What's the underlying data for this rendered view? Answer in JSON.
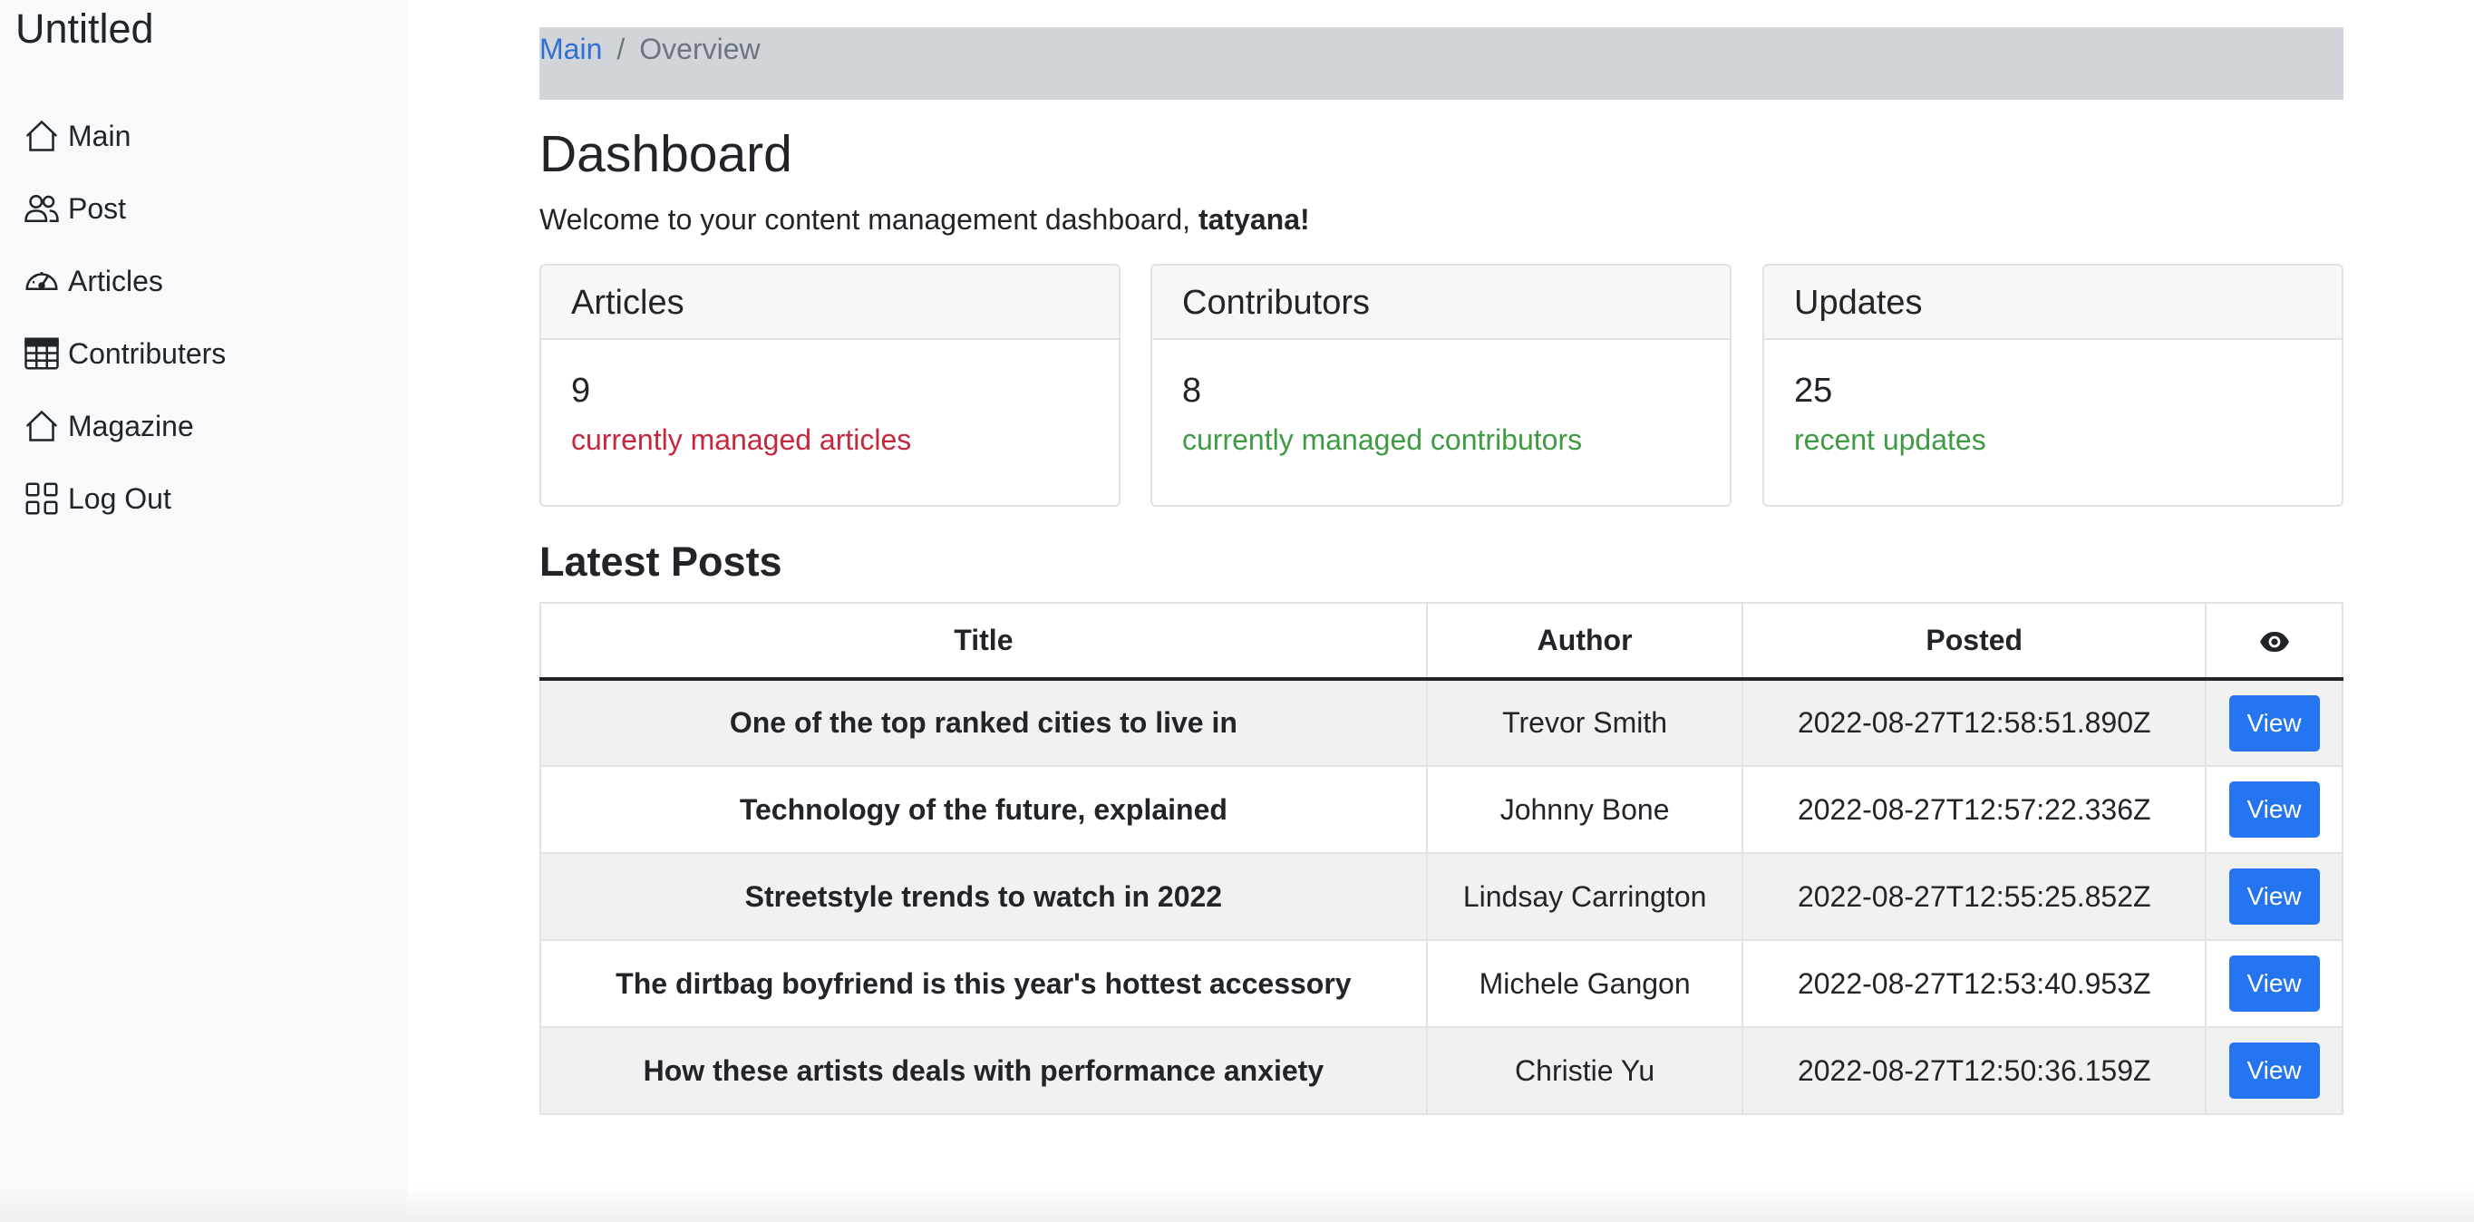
{
  "sidebar": {
    "brand": "Untitled",
    "items": [
      {
        "label": "Main",
        "icon": "home-icon"
      },
      {
        "label": "Post",
        "icon": "people-icon"
      },
      {
        "label": "Articles",
        "icon": "speedometer-icon"
      },
      {
        "label": "Contributers",
        "icon": "table-icon"
      },
      {
        "label": "Magazine",
        "icon": "home-icon"
      },
      {
        "label": "Log Out",
        "icon": "grid-icon"
      }
    ]
  },
  "breadcrumb": {
    "link": "Main",
    "separator": "/",
    "current": "Overview"
  },
  "page": {
    "title": "Dashboard",
    "welcome_prefix": "Welcome to your content management dashboard, ",
    "user": "tatyana!"
  },
  "cards": [
    {
      "title": "Articles",
      "value": "9",
      "subtitle": "currently managed articles",
      "color": "#c5283d"
    },
    {
      "title": "Contributors",
      "value": "8",
      "subtitle": "currently managed contributors",
      "color": "#3f9b43"
    },
    {
      "title": "Updates",
      "value": "25",
      "subtitle": "recent updates",
      "color": "#3f9b43"
    }
  ],
  "latest_posts": {
    "title": "Latest Posts",
    "columns": {
      "title": "Title",
      "author": "Author",
      "posted": "Posted",
      "view_icon": "eye-icon"
    },
    "view_label": "View",
    "rows": [
      {
        "title": "One of the top ranked cities to live in",
        "author": "Trevor Smith",
        "posted": "2022-08-27T12:58:51.890Z"
      },
      {
        "title": "Technology of the future, explained",
        "author": "Johnny Bone",
        "posted": "2022-08-27T12:57:22.336Z"
      },
      {
        "title": "Streetstyle trends to watch in 2022",
        "author": "Lindsay Carrington",
        "posted": "2022-08-27T12:55:25.852Z"
      },
      {
        "title": "The dirtbag boyfriend is this year's hottest accessory",
        "author": "Michele Gangon",
        "posted": "2022-08-27T12:53:40.953Z"
      },
      {
        "title": "How these artists deals with performance anxiety",
        "author": "Christie Yu",
        "posted": "2022-08-27T12:50:36.159Z"
      }
    ]
  },
  "colors": {
    "accent": "#2574f0",
    "link": "#2f6fd6",
    "danger": "#c5283d",
    "success": "#3f9b43",
    "sidebar_bg": "#f8f9fb",
    "breadcrumb_bg": "#d1d5da"
  }
}
